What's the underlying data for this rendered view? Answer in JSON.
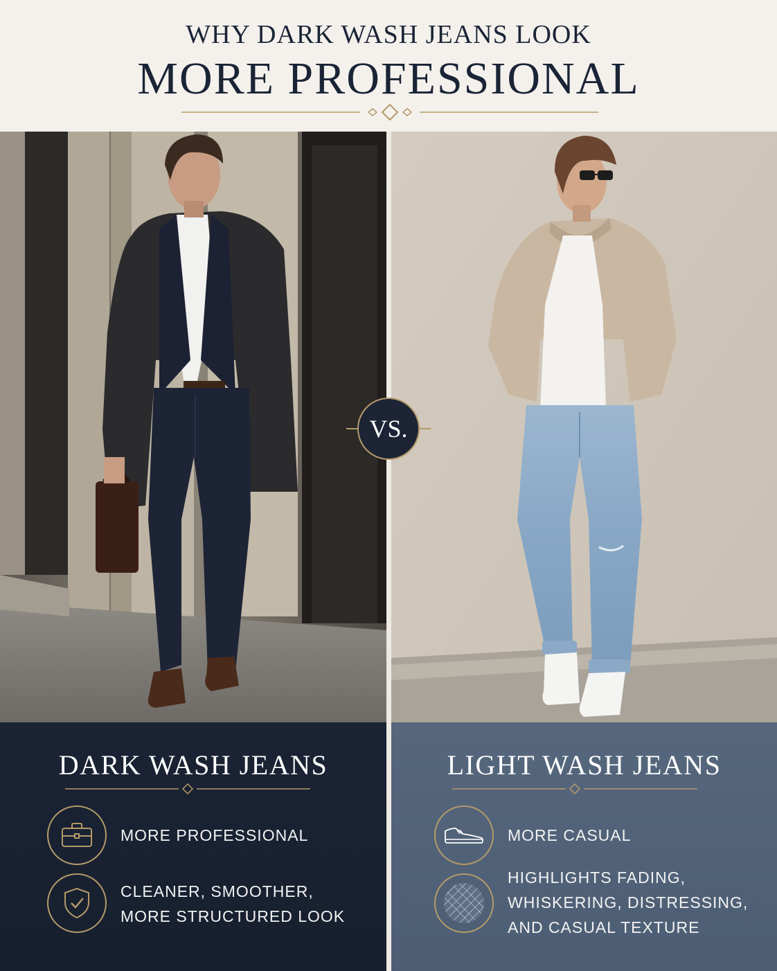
{
  "header": {
    "subtitle": "WHY DARK WASH JEANS LOOK",
    "title": "MORE PROFESSIONAL"
  },
  "vs_label": "VS.",
  "colors": {
    "navy": "#1a2334",
    "slate_blue": "#56677d",
    "gold": "#b59a6a",
    "cream": "#f4f1ec"
  },
  "left_panel": {
    "title": "DARK WASH JEANS",
    "features": [
      {
        "icon": "briefcase-icon",
        "lines": [
          "MORE PROFESSIONAL"
        ]
      },
      {
        "icon": "shield-check-icon",
        "lines": [
          "CLEANER, SMOOTHER,",
          "MORE STRUCTURED LOOK"
        ]
      }
    ]
  },
  "right_panel": {
    "title": "LIGHT WASH JEANS",
    "features": [
      {
        "icon": "sneaker-icon",
        "lines": [
          "MORE CASUAL"
        ]
      },
      {
        "icon": "denim-texture-icon",
        "lines": [
          "HIGHLIGHTS FADING,",
          "WHISKERING, DISTRESSING,",
          "AND CASUAL TEXTURE"
        ]
      }
    ]
  }
}
